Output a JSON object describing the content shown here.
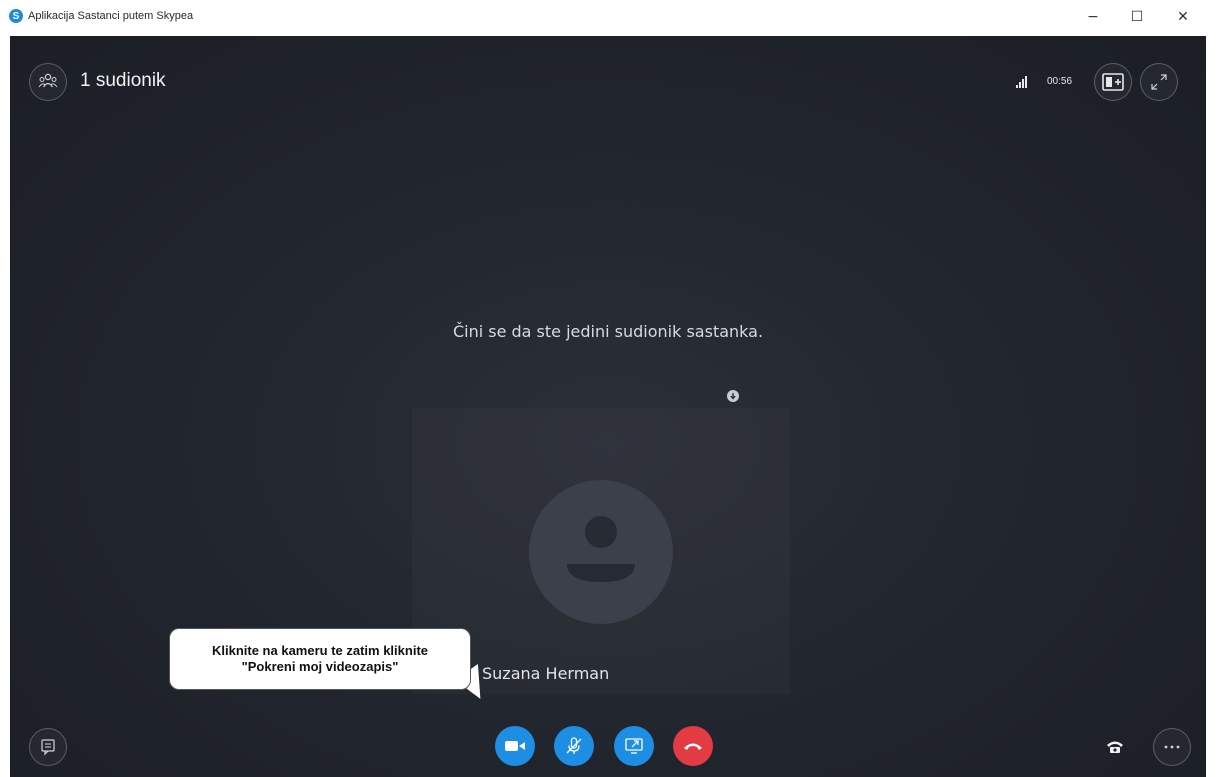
{
  "window": {
    "title": "Aplikacija Sastanci putem Skypea",
    "logo_letter": "S",
    "minimize_glyph": "−",
    "maximize_glyph": "☐",
    "close_glyph": "✕"
  },
  "header": {
    "participants_label": "1 sudionik",
    "call_timer": "00:56"
  },
  "stage": {
    "message": "Čini se da ste jedini sudionik sastanka.",
    "participant_name": "Suzana Herman"
  },
  "tooltip": {
    "line1": "Kliknite na kameru te zatim kliknite",
    "line2": "\"Pokreni moj videozapis\""
  },
  "colors": {
    "accent_blue": "#1e8ee5",
    "hangup_red": "#e23b43",
    "background": "#22262e"
  },
  "icons": {
    "participants": "people-icon",
    "signal": "signal-strength-icon",
    "layout": "layout-icon",
    "fullscreen": "expand-icon",
    "chat": "chat-icon",
    "camera": "video-camera-icon",
    "microphone": "microphone-muted-icon",
    "share": "share-screen-icon",
    "hangup": "hang-up-icon",
    "dialpad": "phone-icon",
    "more": "more-options-icon"
  }
}
